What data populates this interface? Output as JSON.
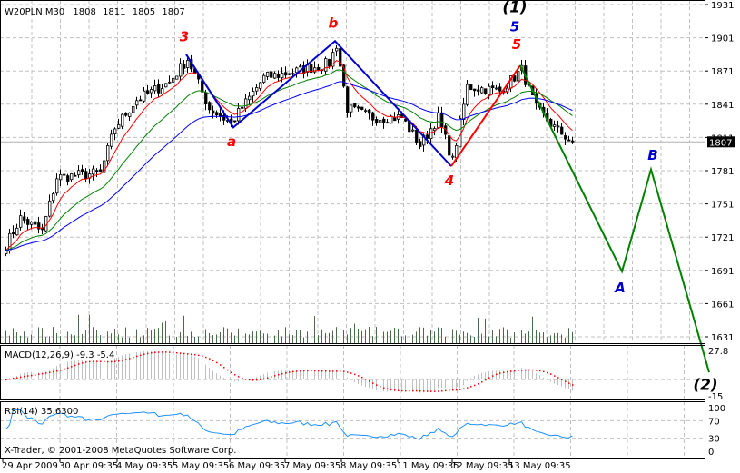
{
  "chart_data": {
    "type": "candlestick",
    "header": {
      "symbol": "W20PLN,M30",
      "open": "1808",
      "high": "1811",
      "low": "1805",
      "close": "1807"
    },
    "price_axis": {
      "ticks": [
        "1931",
        "1901",
        "1871",
        "1841",
        "1811",
        "1781",
        "1751",
        "1721",
        "1691",
        "1661",
        "1631"
      ],
      "range": [
        1631,
        1931
      ],
      "current": "1807"
    },
    "time_axis": {
      "labels": [
        "29 Apr 2009",
        "30 Apr 09:35",
        "4 May 09:35",
        "5 May 09:35",
        "6 May 09:35",
        "7 May 09:35",
        "8 May 09:35",
        "11 May 09:35",
        "12 May 09:35",
        "13 May 09:35"
      ]
    },
    "grid": true,
    "close_path": [
      {
        "bar": 0,
        "price": 1714
      },
      {
        "bar": 4,
        "price": 1738
      },
      {
        "bar": 10,
        "price": 1726
      },
      {
        "bar": 14,
        "price": 1775
      },
      {
        "bar": 26,
        "price": 1779
      },
      {
        "bar": 30,
        "price": 1820
      },
      {
        "bar": 36,
        "price": 1845
      },
      {
        "bar": 45,
        "price": 1861
      },
      {
        "bar": 50,
        "price": 1882
      },
      {
        "bar": 56,
        "price": 1837
      },
      {
        "bar": 62,
        "price": 1824
      },
      {
        "bar": 71,
        "price": 1865
      },
      {
        "bar": 79,
        "price": 1870
      },
      {
        "bar": 89,
        "price": 1878
      },
      {
        "bar": 91,
        "price": 1895
      },
      {
        "bar": 94,
        "price": 1837
      },
      {
        "bar": 101,
        "price": 1829
      },
      {
        "bar": 109,
        "price": 1829
      },
      {
        "bar": 114,
        "price": 1804
      },
      {
        "bar": 119,
        "price": 1829
      },
      {
        "bar": 123,
        "price": 1790
      },
      {
        "bar": 127,
        "price": 1857
      },
      {
        "bar": 136,
        "price": 1853
      },
      {
        "bar": 142,
        "price": 1872
      },
      {
        "bar": 146,
        "price": 1837
      },
      {
        "bar": 151,
        "price": 1820
      },
      {
        "bar": 156,
        "price": 1807
      }
    ],
    "moving_averages": [
      {
        "color": "#ff0000",
        "period": 8
      },
      {
        "color": "#008000",
        "period": 21
      },
      {
        "color": "#0000ff",
        "period": 40
      }
    ],
    "wave_lines": [
      {
        "color": "#0000cc",
        "points": [
          {
            "bar": 50,
            "price": 1886
          },
          {
            "bar": 63,
            "price": 1820
          },
          {
            "bar": 91,
            "price": 1898
          },
          {
            "bar": 123,
            "price": 1785
          }
        ]
      },
      {
        "color": "#ff0000",
        "points": [
          {
            "bar": 123,
            "price": 1785
          },
          {
            "bar": 142,
            "price": 1876
          }
        ]
      },
      {
        "color": "#008000",
        "points": [
          {
            "bar": 142,
            "price": 1876
          },
          {
            "bar": 170,
            "price": 1690
          },
          {
            "bar": 178,
            "price": 1782
          },
          {
            "bar": 194,
            "price": 1599
          }
        ]
      }
    ],
    "wave_labels": [
      {
        "text": "3",
        "color": "#ff0000",
        "bar": 49.5,
        "price": 1898
      },
      {
        "text": "a",
        "color": "#ff0000",
        "bar": 62.5,
        "price": 1803
      },
      {
        "text": "b",
        "color": "#ff0000",
        "bar": 90.5,
        "price": 1910
      },
      {
        "text": "4",
        "color": "#ff0000",
        "bar": 122.5,
        "price": 1768
      },
      {
        "text": "5",
        "color": "#ff0000",
        "bar": 141,
        "price": 1891
      },
      {
        "text": "5",
        "color": "#0000cc",
        "bar": 140.5,
        "price": 1907
      },
      {
        "text": "(1)",
        "color": "#000000",
        "bar": 140.5,
        "price": 1924
      },
      {
        "text": "B",
        "color": "#0000cc",
        "bar": 178.5,
        "price": 1791
      },
      {
        "text": "A",
        "color": "#0000cc",
        "bar": 169.5,
        "price": 1671
      },
      {
        "text": "(2)",
        "color": "#000000",
        "bar": 193,
        "price": 1583
      }
    ],
    "macd": {
      "label": "MACD(12,26,9) -9.3 -5.4",
      "ticks": [
        "27.8",
        "-15"
      ],
      "range": [
        -15,
        27.8
      ],
      "histogram_color": "#c0c0c0",
      "signal_color": "#ff0000"
    },
    "rsi": {
      "label": "RSI(14) 35.6300",
      "ticks": [
        "100",
        "70",
        "30",
        "0"
      ],
      "levels": [
        70,
        30
      ],
      "value": 35.63,
      "color": "#1e90ff"
    },
    "copyright": "X-Trader, © 2001-2008 MetaQuotes Software Corp."
  }
}
